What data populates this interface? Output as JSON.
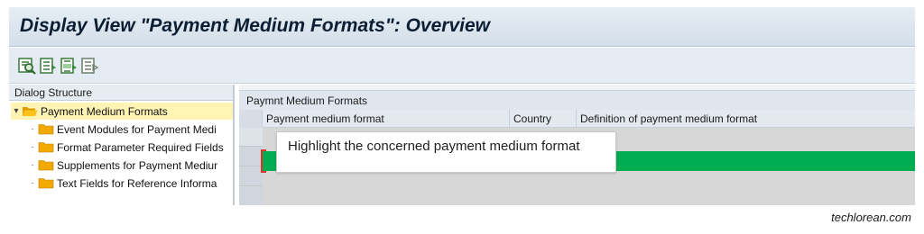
{
  "window": {
    "title": "Display View \"Payment Medium Formats\": Overview"
  },
  "toolbar": {
    "buttons": [
      {
        "icon": "search-details-icon"
      },
      {
        "icon": "select-all-icon"
      },
      {
        "icon": "select-block-icon"
      },
      {
        "icon": "deselect-all-icon"
      }
    ]
  },
  "dialog_structure": {
    "header": "Dialog Structure",
    "items": [
      {
        "label": "Payment Medium Formats",
        "selected": true,
        "open": true
      },
      {
        "label": "Event Modules for Payment Medi"
      },
      {
        "label": "Format Parameter Required Fields"
      },
      {
        "label": "Supplements for Payment Mediur"
      },
      {
        "label": "Text Fields for Reference Informa"
      }
    ]
  },
  "table": {
    "title": "Paymnt Medium Formats",
    "columns": [
      "Payment medium format",
      "Country",
      "Definition of payment medium format"
    ]
  },
  "callout": {
    "text": "Highlight the concerned payment medium format"
  },
  "watermark": "techlorean.com",
  "colors": {
    "highlight": "#00ac50",
    "selected_tree_item": "#fff4b4",
    "folder": "#f2a900",
    "title_text": "#0b1e33"
  }
}
